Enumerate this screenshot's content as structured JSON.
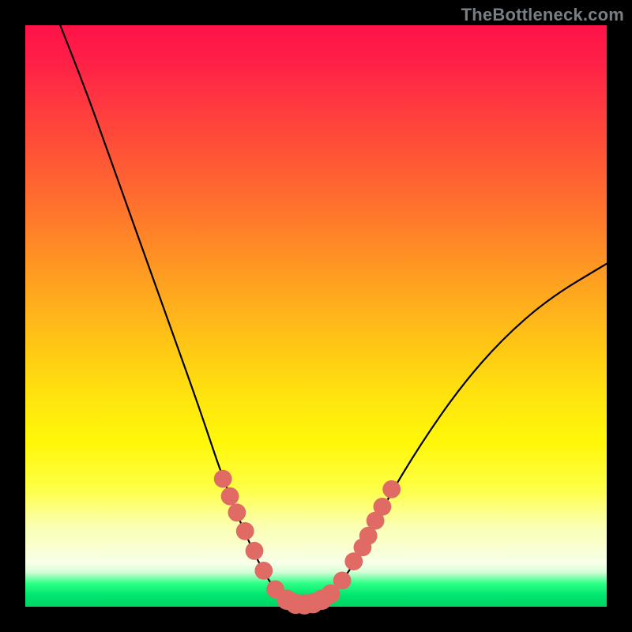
{
  "watermark": "TheBottleneck.com",
  "colors": {
    "frame": "#000000",
    "bead": "#e06a64",
    "curve": "#000000",
    "gradient_stops": [
      "#ff1348",
      "#ff7c2a",
      "#ffe40e",
      "#f8ffe8",
      "#00d464"
    ]
  },
  "chart_data": {
    "type": "line",
    "title": "",
    "xlabel": "",
    "ylabel": "",
    "xlim": [
      0,
      100
    ],
    "ylim": [
      0,
      100
    ],
    "grid": false,
    "legend": false,
    "note": "V-shaped curve over rainbow heat gradient; minimum near x≈47, y≈0. Coral beads cluster on both descending and ascending limbs near the bottom.",
    "curve_points": [
      {
        "x": 6,
        "y": 100
      },
      {
        "x": 10,
        "y": 90
      },
      {
        "x": 15,
        "y": 76
      },
      {
        "x": 20,
        "y": 62
      },
      {
        "x": 25,
        "y": 48
      },
      {
        "x": 30,
        "y": 34
      },
      {
        "x": 34,
        "y": 22
      },
      {
        "x": 38,
        "y": 12
      },
      {
        "x": 42,
        "y": 4
      },
      {
        "x": 45,
        "y": 1
      },
      {
        "x": 47,
        "y": 0.2
      },
      {
        "x": 49,
        "y": 0.3
      },
      {
        "x": 52,
        "y": 1.5
      },
      {
        "x": 55,
        "y": 5
      },
      {
        "x": 58,
        "y": 10
      },
      {
        "x": 62,
        "y": 18
      },
      {
        "x": 68,
        "y": 28
      },
      {
        "x": 75,
        "y": 38
      },
      {
        "x": 82,
        "y": 46
      },
      {
        "x": 90,
        "y": 53
      },
      {
        "x": 100,
        "y": 59
      }
    ],
    "beads": [
      {
        "x": 34.0,
        "y": 22.0,
        "r": 1.0
      },
      {
        "x": 35.2,
        "y": 19.0,
        "r": 1.0
      },
      {
        "x": 36.4,
        "y": 16.2,
        "r": 1.0
      },
      {
        "x": 37.8,
        "y": 13.0,
        "r": 1.0
      },
      {
        "x": 39.4,
        "y": 9.6,
        "r": 1.0
      },
      {
        "x": 41.0,
        "y": 6.2,
        "r": 1.0
      },
      {
        "x": 43.0,
        "y": 3.0,
        "r": 1.0
      },
      {
        "x": 45.0,
        "y": 1.2,
        "r": 1.2
      },
      {
        "x": 46.5,
        "y": 0.5,
        "r": 1.2
      },
      {
        "x": 48.0,
        "y": 0.4,
        "r": 1.2
      },
      {
        "x": 49.5,
        "y": 0.6,
        "r": 1.2
      },
      {
        "x": 51.0,
        "y": 1.2,
        "r": 1.2
      },
      {
        "x": 52.5,
        "y": 2.2,
        "r": 1.1
      },
      {
        "x": 54.5,
        "y": 4.5,
        "r": 1.0
      },
      {
        "x": 56.5,
        "y": 7.8,
        "r": 1.0
      },
      {
        "x": 58.0,
        "y": 10.2,
        "r": 1.0
      },
      {
        "x": 59.0,
        "y": 12.2,
        "r": 1.0
      },
      {
        "x": 60.2,
        "y": 14.8,
        "r": 1.0
      },
      {
        "x": 61.4,
        "y": 17.2,
        "r": 1.0
      },
      {
        "x": 63.0,
        "y": 20.2,
        "r": 1.0
      }
    ]
  }
}
